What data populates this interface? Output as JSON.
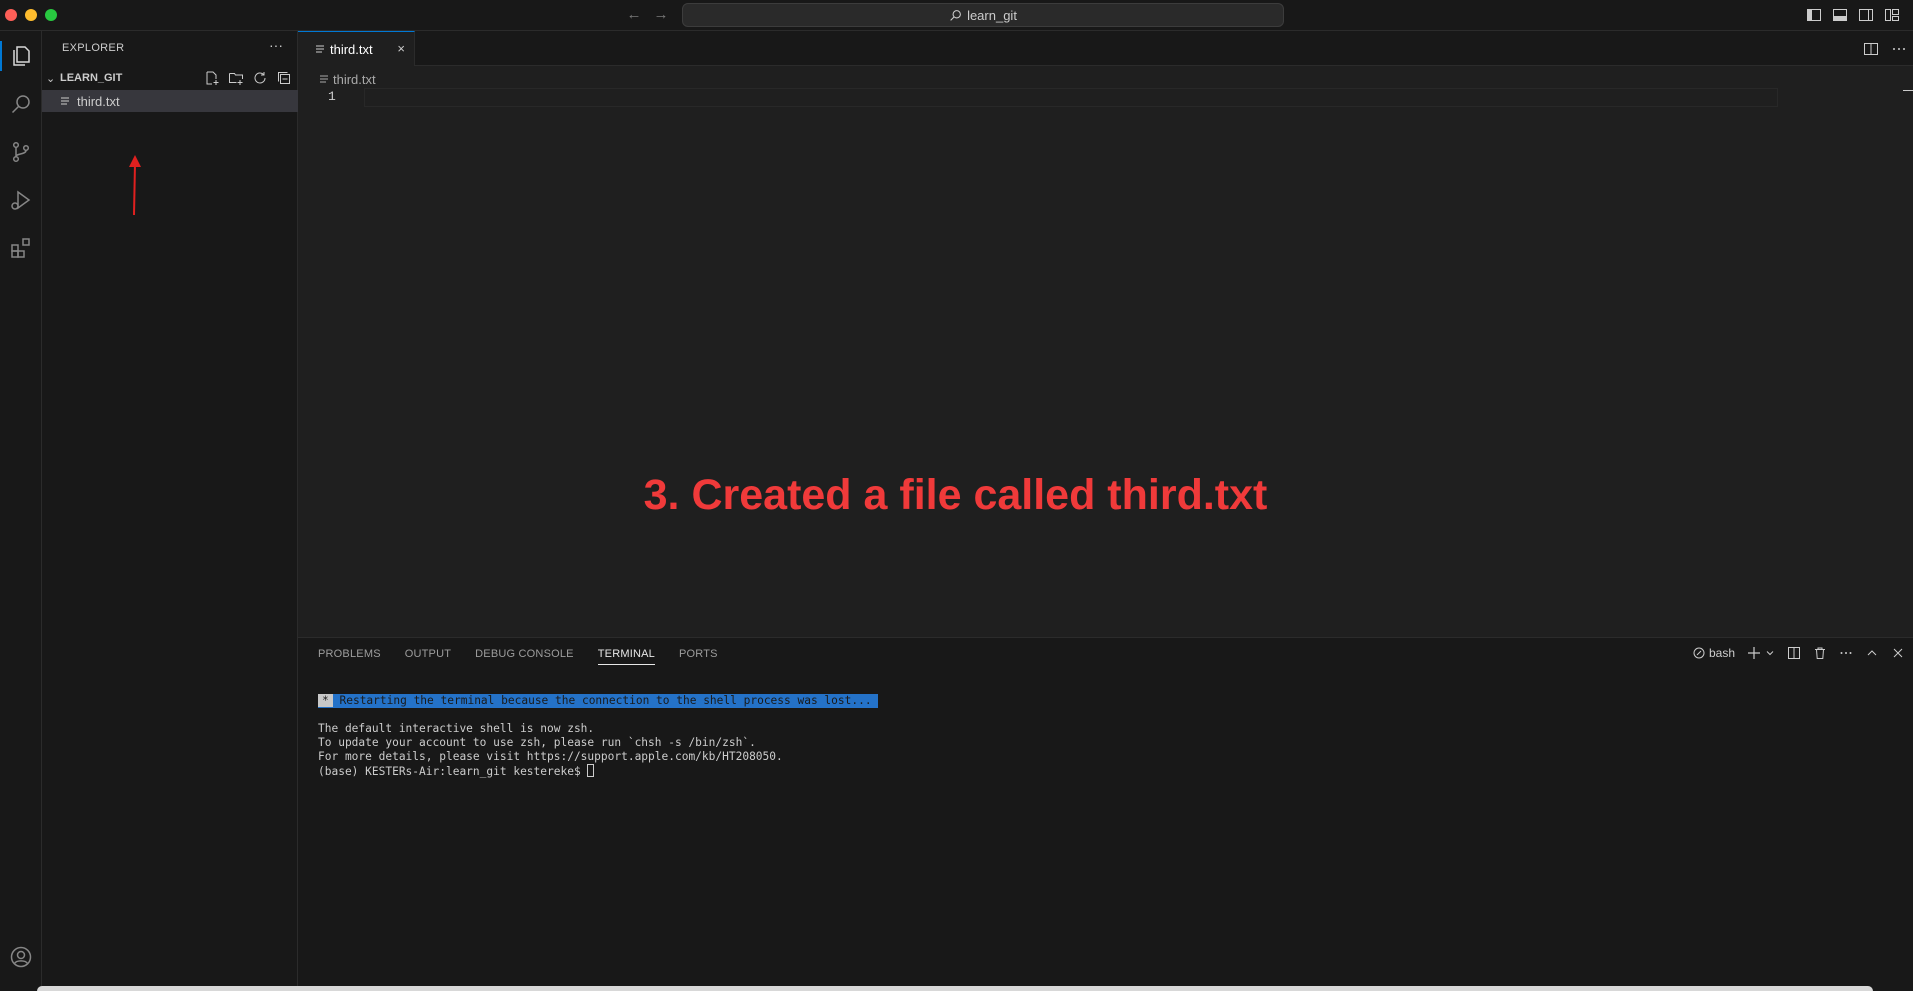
{
  "titlebar": {
    "search_text": "learn_git",
    "back_arrow": "←",
    "forward_arrow": "→"
  },
  "sidebar": {
    "title": "EXPLORER",
    "more": "···",
    "section_label": "LEARN_GIT",
    "files": [
      {
        "name": "third.txt"
      }
    ]
  },
  "editor": {
    "tab_label": "third.txt",
    "tab_close": "×",
    "breadcrumb": "third.txt",
    "line_number": "1",
    "annotation": "3. Created a file called third.txt"
  },
  "panel": {
    "tabs": [
      "PROBLEMS",
      "OUTPUT",
      "DEBUG CONSOLE",
      "TERMINAL",
      "PORTS"
    ],
    "active_tab": "TERMINAL",
    "shell_label": "bash",
    "terminal": {
      "restart_star": "*",
      "restart_msg": " Restarting the terminal because the connection to the shell process was lost... ",
      "lines": [
        "The default interactive shell is now zsh.",
        "To update your account to use zsh, please run `chsh -s /bin/zsh`.",
        "For more details, please visit https://support.apple.com/kb/HT208050."
      ],
      "prompt": "(base) KESTERs-Air:learn_git kestereke$ "
    }
  },
  "colors": {
    "accent": "#0078d4",
    "annotation": "#f03a3a",
    "terminal_highlight": "#2472c8"
  }
}
